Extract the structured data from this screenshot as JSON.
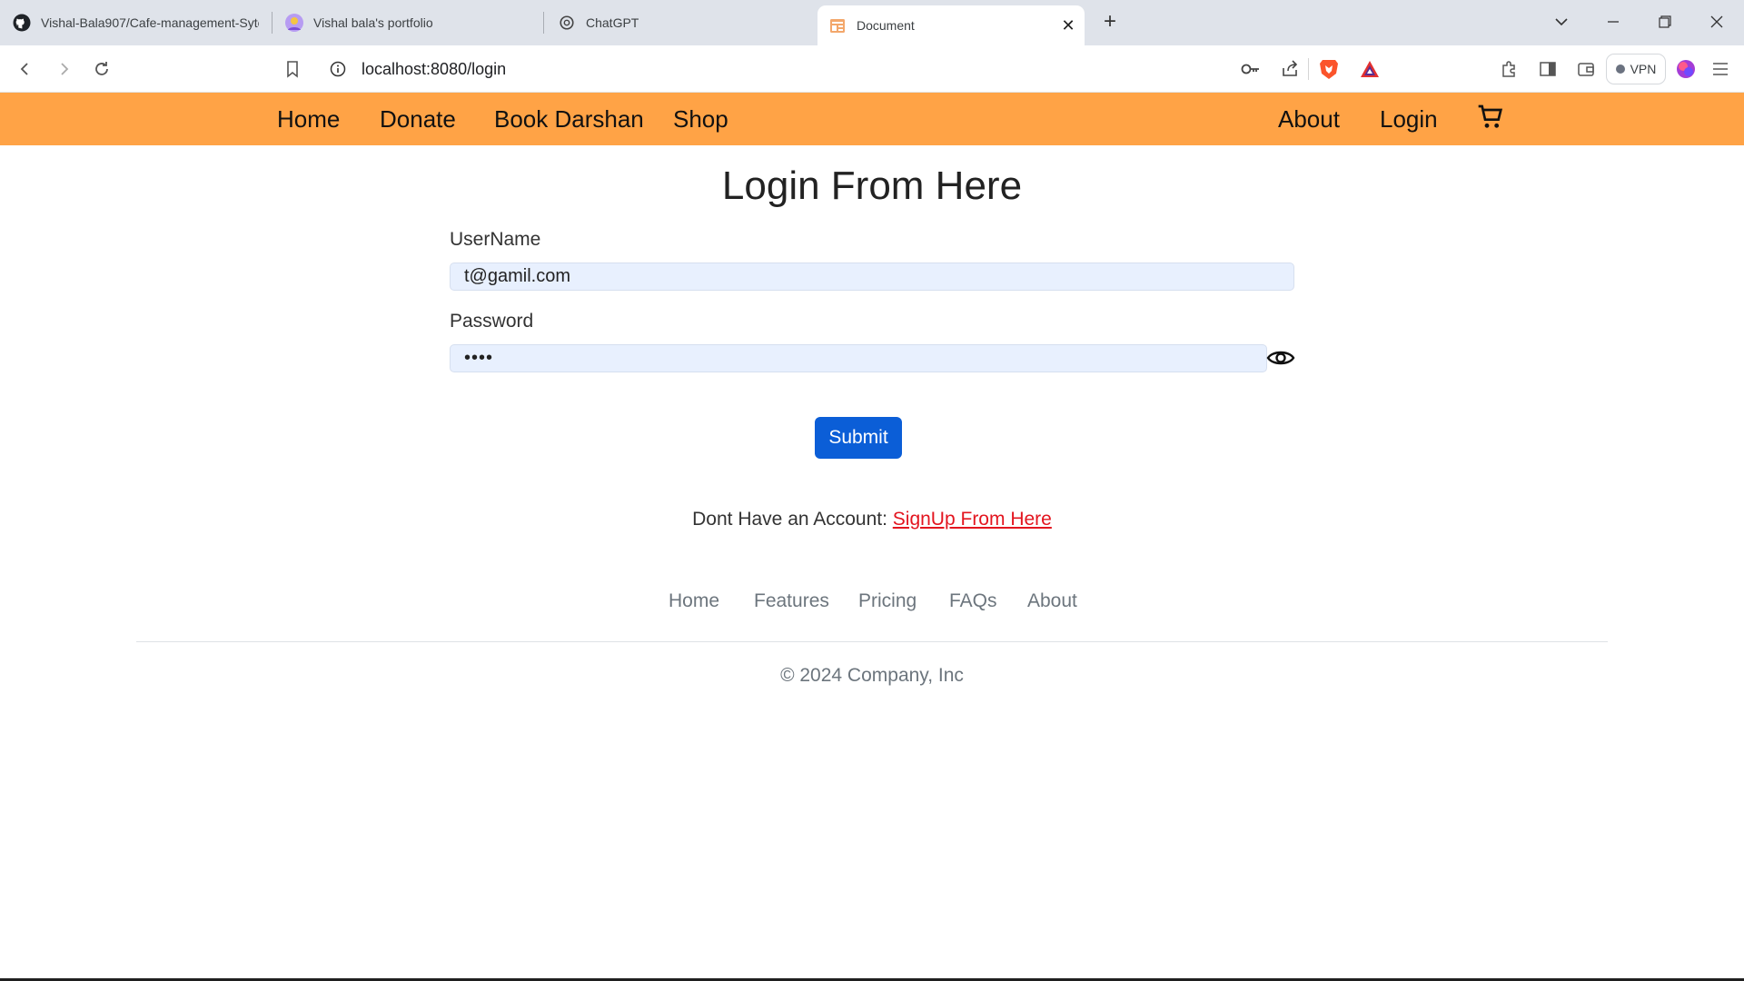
{
  "browser": {
    "tabs": [
      {
        "title": "Vishal-Bala907/Cafe-management-Sytem",
        "icon": "github-icon"
      },
      {
        "title": "Vishal bala's portfolio",
        "icon": "avatar-icon"
      },
      {
        "title": "ChatGPT",
        "icon": "chatgpt-icon"
      },
      {
        "title": "Document",
        "icon": "document-icon",
        "active": true
      }
    ],
    "url": "localhost:8080/login",
    "vpn_label": "VPN"
  },
  "navbar": {
    "left": [
      "Home",
      "Donate",
      "Book Darshan",
      "Shop"
    ],
    "right": [
      "About",
      "Login"
    ],
    "cart_icon": "shopping-cart-icon",
    "background": "#ffa346"
  },
  "login": {
    "title": "Login From Here",
    "username_label": "UserName",
    "username_value": "t@gamil.com",
    "password_label": "Password",
    "password_value": "••••",
    "submit_label": "Submit",
    "account_prompt": "Dont Have an Account: ",
    "signup_link": "SignUp From Here"
  },
  "footer": {
    "links": [
      "Home",
      "Features",
      "Pricing",
      "FAQs",
      "About"
    ],
    "copyright": "© 2024 Company, Inc"
  },
  "colors": {
    "submit": "#0b5ed7",
    "link": "#e3151f",
    "input_fill": "#e8f0fe"
  }
}
